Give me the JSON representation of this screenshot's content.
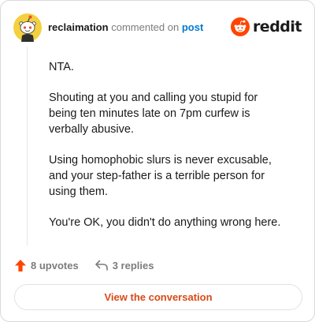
{
  "header": {
    "author": "reclaimation",
    "verb": "commented on",
    "post_link": "post",
    "brand": "reddit"
  },
  "comment": {
    "paragraphs": [
      "NTA.",
      "Shouting at you and calling you stupid for being ten minutes late on 7pm curfew is verbally abusive.",
      "Using homophobic slurs is never excusable, and your step-father is a terrible person for using them.",
      "You're OK, you didn't do anything wrong here."
    ]
  },
  "footer": {
    "upvotes": "8 upvotes",
    "replies": "3 replies",
    "cta": "View the conversation"
  },
  "colors": {
    "brand_orange": "#ff4500",
    "upvote_orange": "#ff4500",
    "link_blue": "#0079d3",
    "cta_text": "#d94a16",
    "avatar_yellow": "#f4d03f"
  },
  "icons": {
    "avatar": "snoo-avatar-icon",
    "brand": "reddit-logo-icon",
    "upvote": "upvote-arrow-icon",
    "reply": "reply-arrow-icon"
  }
}
